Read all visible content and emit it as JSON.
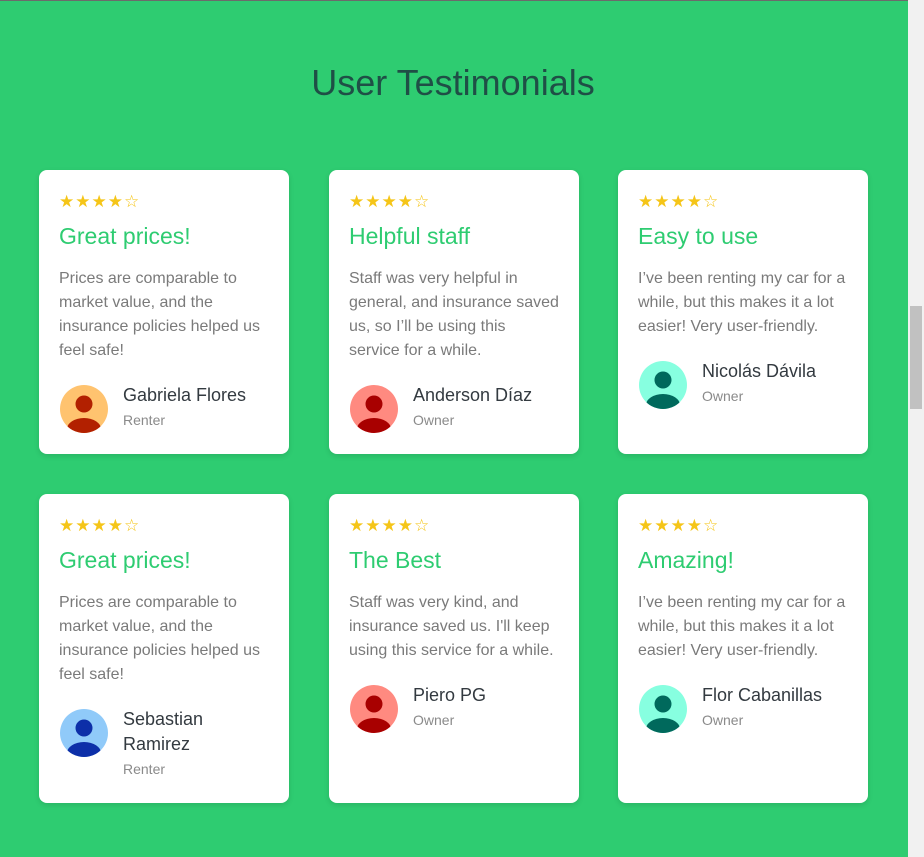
{
  "section": {
    "title": "User Testimonials"
  },
  "colors": {
    "background": "#2ecc71",
    "accent": "#2ecc71",
    "star": "#f5c518"
  },
  "testimonials": [
    {
      "rating": 4,
      "stars": "★★★★☆",
      "title": "Great prices!",
      "text": "Prices are comparable to market value, and the insurance policies helped us feel safe!",
      "author": "Gabriela Flores",
      "role": "Renter",
      "avatar_icon": "user-avatar-icon",
      "avatar_bg": "#ffc36f",
      "avatar_fg": "#b22000"
    },
    {
      "rating": 4,
      "stars": "★★★★☆",
      "title": "Helpful staff",
      "text": "Staff was very helpful in general, and insurance saved us, so I’ll be using this service for a while.",
      "author": "Anderson Díaz",
      "role": "Owner",
      "avatar_icon": "user-avatar-icon",
      "avatar_bg": "#ff8a80",
      "avatar_fg": "#a80000"
    },
    {
      "rating": 4,
      "stars": "★★★★☆",
      "title": "Easy to use",
      "text": "I’ve been renting my car for a while, but this makes it a lot easier! Very user-friendly.",
      "author": "Nicolás Dávila",
      "role": "Owner",
      "avatar_icon": "user-avatar-icon",
      "avatar_bg": "#87ffe0",
      "avatar_fg": "#00695c"
    },
    {
      "rating": 4,
      "stars": "★★★★☆",
      "title": "Great prices!",
      "text": "Prices are comparable to market value, and the insurance policies helped us feel safe!",
      "author": "Sebastian Ramirez",
      "role": "Renter",
      "avatar_icon": "user-avatar-icon",
      "avatar_bg": "#90caf9",
      "avatar_fg": "#0d2fa8"
    },
    {
      "rating": 4,
      "stars": "★★★★☆",
      "title": "The Best",
      "text": "Staff was very kind, and insurance saved us. I'll keep using this service for a while.",
      "author": "Piero PG",
      "role": "Owner",
      "avatar_icon": "user-avatar-icon",
      "avatar_bg": "#ff8a80",
      "avatar_fg": "#a80000"
    },
    {
      "rating": 4,
      "stars": "★★★★☆",
      "title": "Amazing!",
      "text": "I’ve been renting my car for a while, but this makes it a lot easier! Very user-friendly.",
      "author": "Flor Cabanillas",
      "role": "Owner",
      "avatar_icon": "user-avatar-icon",
      "avatar_bg": "#87ffe0",
      "avatar_fg": "#00695c"
    }
  ]
}
